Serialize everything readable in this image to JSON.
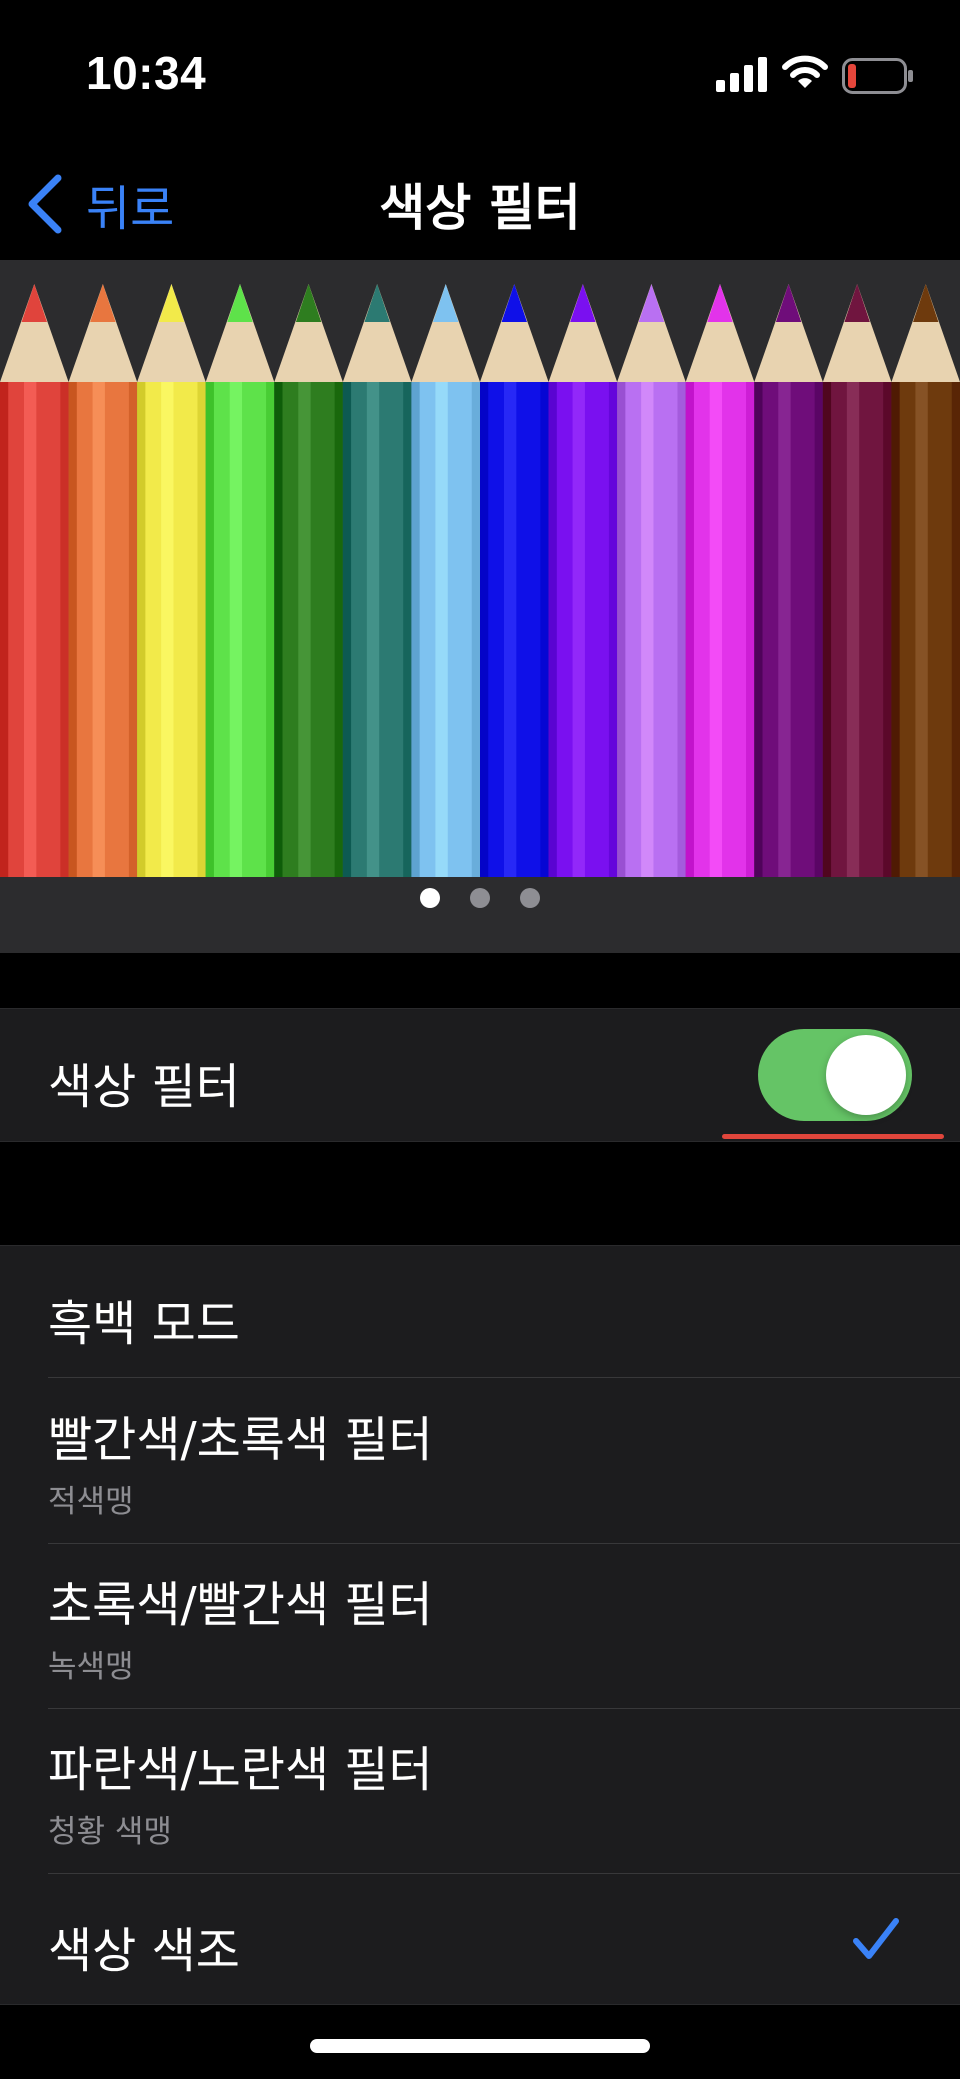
{
  "status_bar": {
    "time": "10:34",
    "icons": [
      "signal-icon",
      "wifi-icon",
      "battery-low-icon"
    ]
  },
  "nav": {
    "back_label": "뒤로",
    "title": "색상 필터"
  },
  "preview": {
    "pencil_colors": [
      "#e0443c",
      "#e8763f",
      "#f2ea4a",
      "#5ee24a",
      "#2e7d1f",
      "#2c7a72",
      "#7ec2f0",
      "#0f10e8",
      "#7a10f0",
      "#b970f2",
      "#e233ea",
      "#6f0d7a",
      "#70153f",
      "#6e3a0d"
    ],
    "page_count": 3,
    "active_page": 1
  },
  "color_filter_toggle": {
    "label": "색상 필터",
    "on": true
  },
  "filters": [
    {
      "title": "흑백 모드",
      "subtitle": "",
      "selected": false
    },
    {
      "title": "빨간색/초록색 필터",
      "subtitle": "적색맹",
      "selected": false
    },
    {
      "title": "초록색/빨간색 필터",
      "subtitle": "녹색맹",
      "selected": false
    },
    {
      "title": "파란색/노란색 필터",
      "subtitle": "청황 색맹",
      "selected": false
    },
    {
      "title": "색상 색조",
      "subtitle": "",
      "selected": true
    }
  ],
  "colors": {
    "accent": "#3a82f7",
    "toggle_on": "#65c466",
    "underline": "#e0463c",
    "battery_low": "#e5463b"
  }
}
